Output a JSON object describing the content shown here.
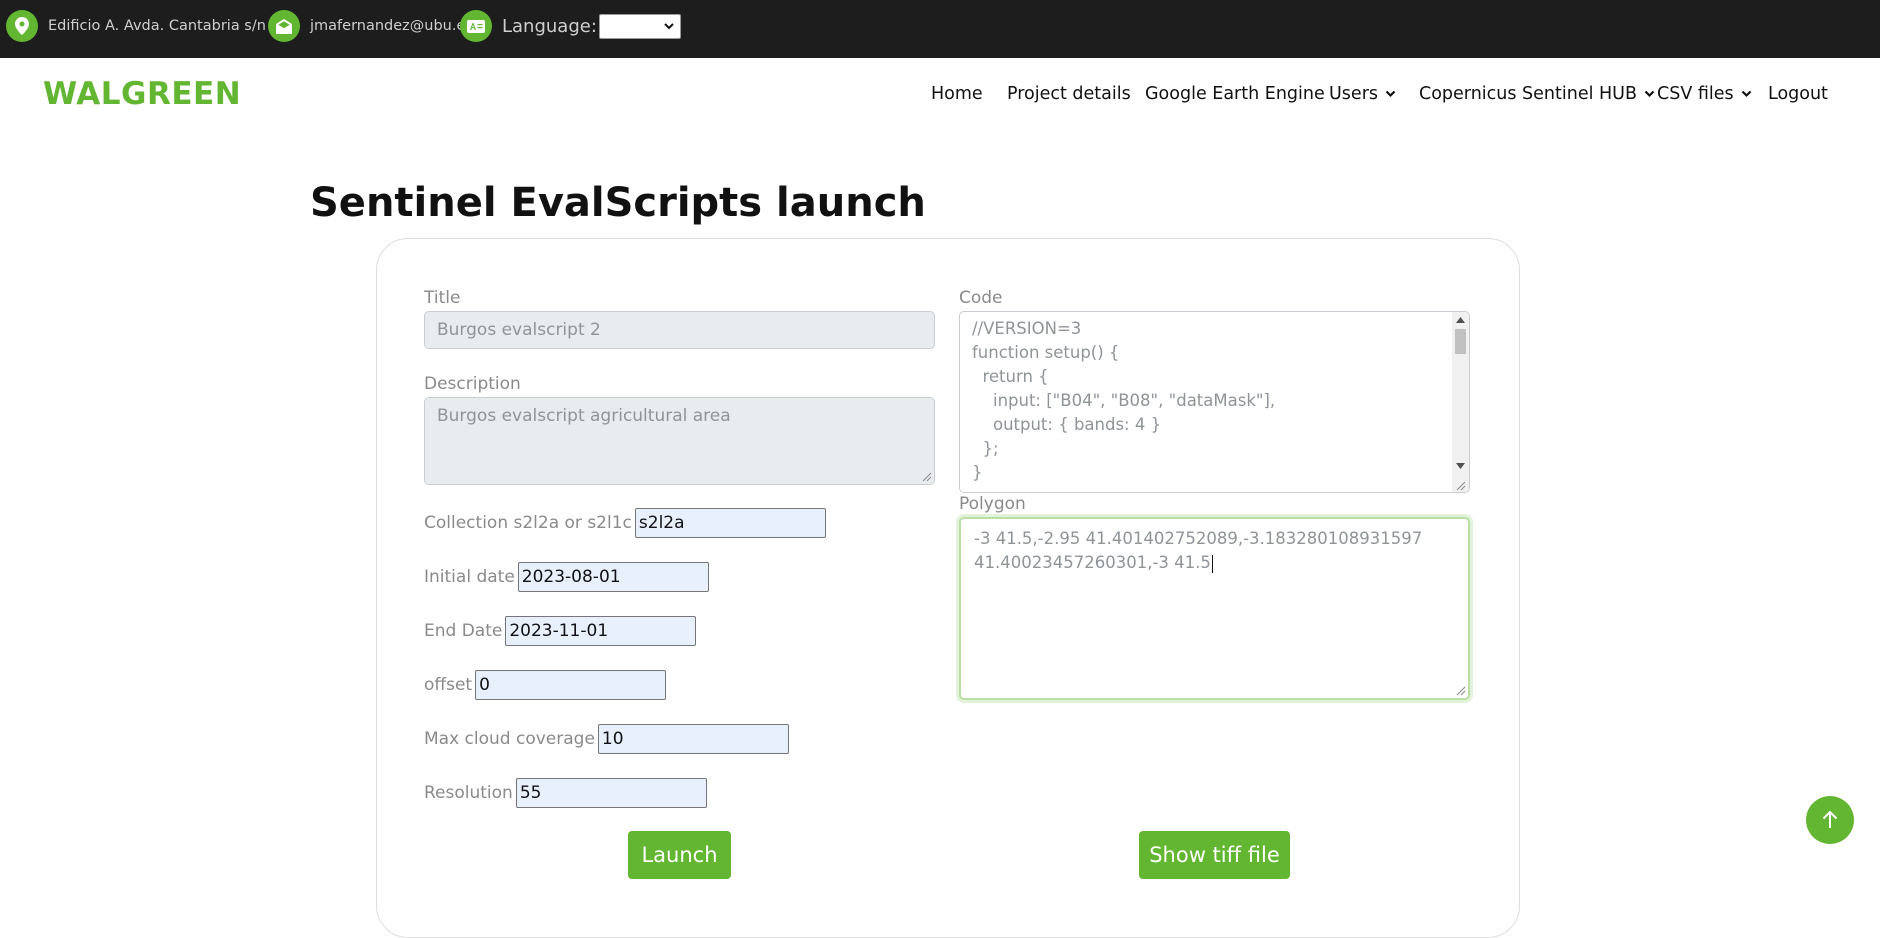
{
  "topbar": {
    "address": "Edificio A. Avda. Cantabria s/n",
    "email": "jmafernandez@ubu.es",
    "language_label": "Language:",
    "language_value": ""
  },
  "header": {
    "logo": "WALGREEN",
    "nav": [
      {
        "label": "Home"
      },
      {
        "label": "Project details"
      },
      {
        "label": "Google Earth Engine"
      },
      {
        "label": "Users"
      },
      {
        "label": "Copernicus Sentinel HUB"
      },
      {
        "label": "CSV files"
      },
      {
        "label": "Logout"
      }
    ]
  },
  "page_title": "Sentinel EvalScripts launch",
  "form": {
    "title_label": "Title",
    "title_value": "Burgos evalscript 2",
    "description_label": "Description",
    "description_value": "Burgos evalscript agricultural area",
    "collection_label": "Collection s2l2a or s2l1c",
    "collection_value": "s2l2a",
    "initial_date_label": "Initial date",
    "initial_date_value": "2023-08-01",
    "end_date_label": "End Date",
    "end_date_value": "2023-11-01",
    "offset_label": "offset",
    "offset_value": "0",
    "max_cloud_label": "Max cloud coverage",
    "max_cloud_value": "10",
    "resolution_label": "Resolution",
    "resolution_value": "55",
    "code_label": "Code",
    "code_lines": [
      "//VERSION=3",
      "function setup() {",
      "  return {",
      "    input: [\"B04\", \"B08\", \"dataMask\"],",
      "    output: { bands: 4 }",
      "  };",
      "}"
    ],
    "polygon_label": "Polygon",
    "polygon_value": "-3 41.5,-2.95 41.401402752089,-3.183280108931597 41.40023457260301,-3 41.5",
    "launch_button": "Launch",
    "show_tiff_button": "Show tiff file"
  },
  "colors": {
    "accent": "#62b632",
    "topbar_bg": "#1d1d1d"
  },
  "icons": {
    "address": "map-pin-icon",
    "email": "envelope-open-icon",
    "language": "translate-icon",
    "back_to_top": "arrow-up-icon"
  }
}
